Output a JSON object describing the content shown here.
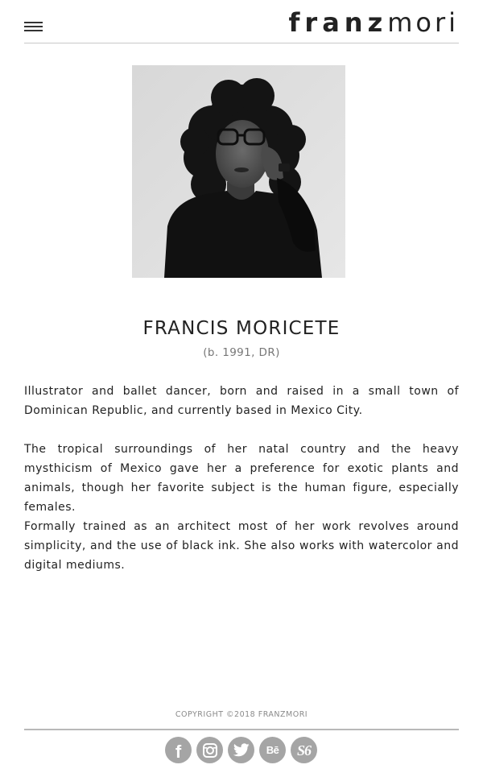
{
  "header": {
    "menu_icon": "hamburger-menu-icon",
    "logo_bold": "franz",
    "logo_light": "mori"
  },
  "profile": {
    "name": "FRANCIS MORICETE",
    "birth": "(b. 1991, DR)"
  },
  "bio": {
    "paragraphs": [
      "Illustrator and ballet dancer, born and raised in a small town of Dominican Republic, and currently based in Mexico City.",
      "The tropical surroundings of her natal country and the heavy mysthicism of Mexico gave her a preference for exotic plants and animals, though her favorite subject is the human figure, especially  females.",
      "Formally trained as an architect most of her work revolves around simplicity, and the use of black ink. She also works with watercolor and digital mediums."
    ]
  },
  "footer": {
    "copyright": "COPYRIGHT ©2018 FRANZMORI",
    "social": [
      {
        "icon": "facebook-icon",
        "glyph": "f"
      },
      {
        "icon": "instagram-icon",
        "glyph": ""
      },
      {
        "icon": "twitter-icon",
        "glyph": ""
      },
      {
        "icon": "behance-icon",
        "glyph": "Bē"
      },
      {
        "icon": "society6-icon",
        "glyph": "S6"
      }
    ]
  },
  "colors": {
    "text": "#222222",
    "muted": "#777777",
    "divider": "#c8c8c8",
    "social_bg": "#a5a5a5"
  }
}
